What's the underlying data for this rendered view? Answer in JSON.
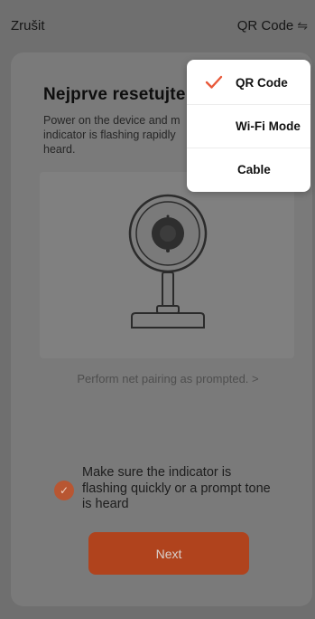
{
  "header": {
    "cancel_label": "Zrušit",
    "mode_label": "QR Code",
    "mode_icon": "swap-icon"
  },
  "instructions": {
    "title": "Nejprve resetujte z",
    "description_lines": [
      "Power on the device and m",
      "indicator is flashing rapidly",
      "heard."
    ]
  },
  "illustration": {
    "icon": "camera-icon"
  },
  "pairing_link": "Perform net pairing as prompted. >",
  "confirmation": {
    "checked": true,
    "lines": [
      "Make sure the indicator is",
      "flashing quickly or a prompt tone",
      "is heard"
    ]
  },
  "next_label": "Next",
  "mode_menu": {
    "items": [
      {
        "label": "QR Code",
        "selected": true
      },
      {
        "label": "Wi-Fi Mode",
        "selected": false
      },
      {
        "label": "Cable",
        "selected": false
      }
    ]
  },
  "colors": {
    "accent": "#b0431d",
    "selected_check": "#e8593a",
    "overlay_bg": "#6f6f6f",
    "menu_bg": "#ffffff"
  }
}
